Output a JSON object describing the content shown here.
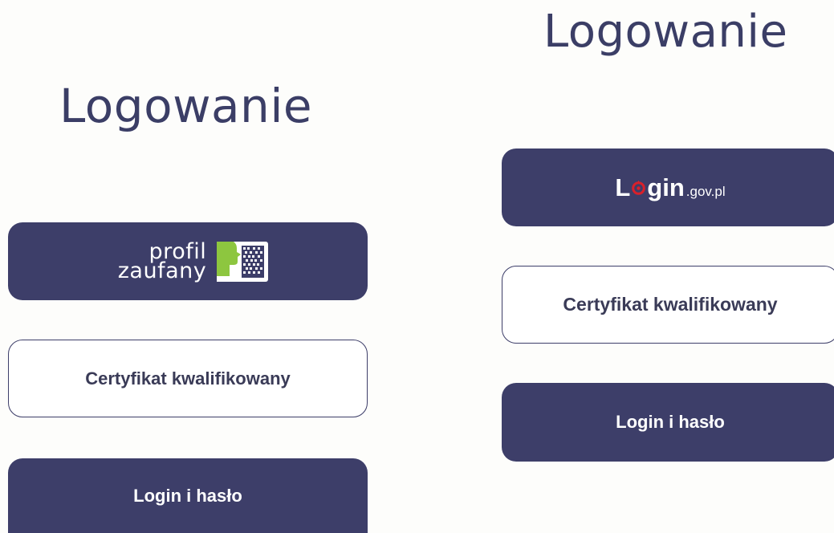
{
  "left": {
    "title": "Logowanie",
    "profil_line1": "profil",
    "profil_line2": "zaufany",
    "cert_label": "Certyfikat kwalifikowany",
    "login_label": "Login i hasło"
  },
  "right": {
    "title": "Logowanie",
    "logingov_l": "L",
    "logingov_gin": "gin",
    "logingov_suffix": ".gov.pl",
    "cert_label": "Certyfikat kwalifikowany",
    "login_label": "Login i hasło"
  },
  "colors": {
    "primary": "#3d3e69",
    "background": "#fdfdfb",
    "accent_green": "#8dc63f",
    "accent_red": "#d9202a"
  },
  "icons": {
    "profil_logo": "profil-zaufany-logo-icon",
    "login_o": "login-gov-o-icon"
  }
}
